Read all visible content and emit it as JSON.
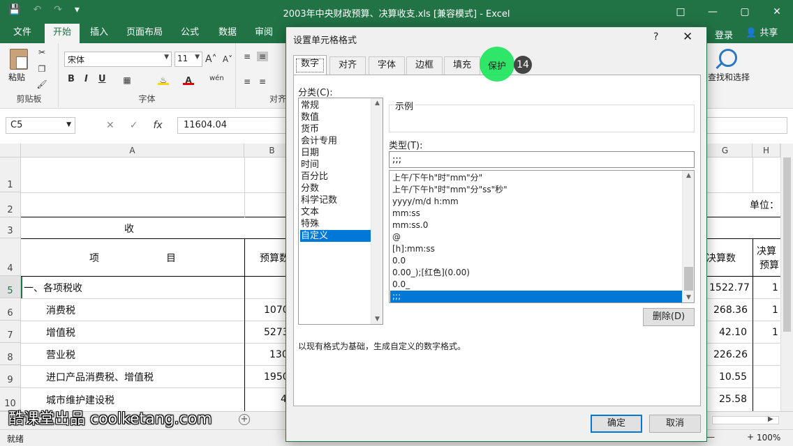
{
  "window": {
    "title": "2003年中央财政预算、决算收支.xls  [兼容模式] - Excel",
    "login": "登录",
    "share": "共享"
  },
  "ribbon_tabs": [
    "文件",
    "开始",
    "插入",
    "页面布局",
    "公式",
    "数据",
    "审阅"
  ],
  "ribbon": {
    "paste": "粘贴",
    "clipboard": "剪贴板",
    "font_group": "字体",
    "align_group": "对齐",
    "font_name": "宋体",
    "font_size": "11",
    "find_select": "查找和选择",
    "bold": "B",
    "italic": "I",
    "underline": "U"
  },
  "formula_bar": {
    "name_box": "C5",
    "fx": "fx",
    "value": "11604.04"
  },
  "sheet": {
    "col_headers": [
      "A",
      "B",
      "G",
      "H"
    ],
    "row_headers": [
      "1",
      "2",
      "3",
      "4",
      "5",
      "6",
      "7",
      "8",
      "9",
      "10"
    ],
    "unit_label": "单位：",
    "row3_label": "收",
    "row4_item": "项",
    "row4_item2": "目",
    "row4_budget": "预算数",
    "row4_final": "决算数",
    "row4_final_budget_1": "决算",
    "row4_final_budget_2": "预算",
    "rows": [
      {
        "label": "一、各项税收",
        "b": "",
        "g": "1522.77",
        "h": "1"
      },
      {
        "label": "消费税",
        "b": "1070",
        "g": "268.36",
        "h": "1"
      },
      {
        "label": "增值税",
        "b": "5273",
        "g": "42.10",
        "h": "1"
      },
      {
        "label": "营业税",
        "b": "130",
        "g": "226.26",
        "h": ""
      },
      {
        "label": "进口产品消费税、增值税",
        "b": "1950",
        "g": "10.55",
        "h": ""
      },
      {
        "label": "城市维护建设税",
        "b": "4",
        "g": "25.58",
        "h": ""
      }
    ]
  },
  "status": {
    "ready": "就绪",
    "zoom": "100%",
    "minus": "—",
    "plus": "+"
  },
  "dialog": {
    "title": "设置单元格格式",
    "help": "?",
    "close": "✕",
    "tabs": [
      "数字",
      "对齐",
      "字体",
      "边框",
      "填充",
      "保护"
    ],
    "category_label": "分类(C):",
    "categories": [
      "常规",
      "数值",
      "货币",
      "会计专用",
      "日期",
      "时间",
      "百分比",
      "分数",
      "科学记数",
      "文本",
      "特殊",
      "自定义"
    ],
    "selected_category": "自定义",
    "sample_label": "示例",
    "type_label": "类型(T):",
    "type_value": ";;;",
    "type_list": [
      "上午/下午h\"时\"mm\"分\"",
      "上午/下午h\"时\"mm\"分\"ss\"秒\"",
      "yyyy/m/d h:mm",
      "mm:ss",
      "mm:ss.0",
      "@",
      "[h]:mm:ss",
      "0.0",
      "0.00_);[红色](0.00)",
      "0.0_",
      ";;;"
    ],
    "delete_button": "删除(D)",
    "description": "以现有格式为基础，生成自定义的数字格式。",
    "ok": "确定",
    "cancel": "取消"
  },
  "tutorial": {
    "step": "14",
    "watermark": "酷课堂出品 coolketang.com"
  }
}
